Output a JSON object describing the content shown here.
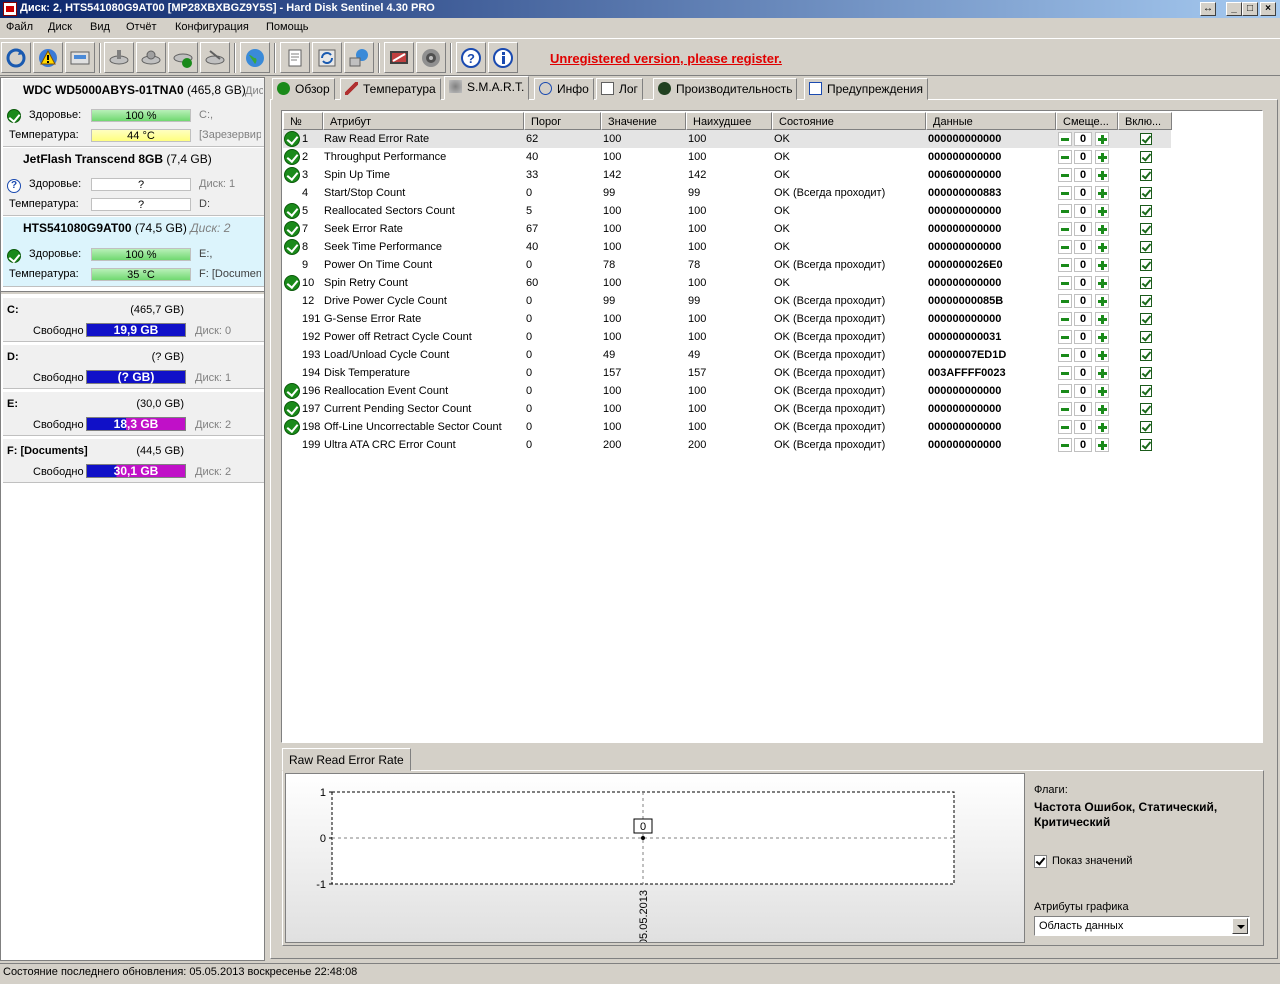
{
  "window": {
    "title": "Диск: 2, HTS541080G9AT00 [MP28XBXBGZ9Y5S]  -  Hard Disk Sentinel 4.30 PRO"
  },
  "menu": [
    "Файл",
    "Диск",
    "Вид",
    "Отчёт",
    "Конфигурация",
    "Помощь"
  ],
  "toolbar": {
    "icons": [
      "refresh-icon",
      "warning-icon",
      "disk-info-icon",
      "disk-test-icon",
      "disk-surface-icon",
      "disk-ok-icon",
      "disk-repair-icon",
      "globe-icon",
      "document-icon",
      "sync-icon",
      "network-icon",
      "report-icon",
      "speaker-icon",
      "help-icon",
      "about-icon"
    ],
    "unregistered": "Unregistered version, please register."
  },
  "disks": [
    {
      "name": "WDC WD5000ABYS-01TNA0",
      "size": "(465,8 GB)",
      "extra": "Дис",
      "health_label": "Здоровье:",
      "health": "100 %",
      "health_extra": "C:,",
      "temp_label": "Температура:",
      "temp": "44 °C",
      "temp_extra": "[Зарезервир"
    },
    {
      "name": "JetFlash Transcend 8GB",
      "size": "(7,4 GB)",
      "health_label": "Здоровье:",
      "health": "?",
      "health_extra": "Диск: 1",
      "temp_label": "Температура:",
      "temp": "?",
      "temp_extra": "D:"
    },
    {
      "name": "HTS541080G9AT00",
      "size": "(74,5 GB)",
      "extra": "Диск: 2",
      "health_label": "Здоровье:",
      "health": "100 %",
      "health_extra": "E:,",
      "temp_label": "Температура:",
      "temp": "35 °C",
      "temp_extra": "F: [Documen"
    }
  ],
  "volumes": [
    {
      "name": "C:",
      "size": "(465,7 GB)",
      "free_label": "Свободно",
      "free": "19,9 GB",
      "disk": "Диск: 0",
      "color": "#1010c8"
    },
    {
      "name": "D:",
      "size": "(? GB)",
      "free_label": "Свободно",
      "free": "(? GB)",
      "disk": "Диск: 1",
      "color": "#1010c8"
    },
    {
      "name": "E:",
      "size": "(30,0 GB)",
      "free_label": "Свободно",
      "free": "18,3 GB",
      "disk": "Диск: 2",
      "color": "#c010c8"
    },
    {
      "name": "F: [Documents]",
      "size": "(44,5 GB)",
      "free_label": "Свободно",
      "free": "30,1 GB",
      "disk": "Диск: 2",
      "color": "#c010c8"
    }
  ],
  "tabs": [
    "Обзор",
    "Температура",
    "S.M.A.R.T.",
    "Инфо",
    "Лог",
    "Производительность",
    "Предупреждения"
  ],
  "table": {
    "headers": [
      "№",
      "Атрибут",
      "Порог",
      "Значение",
      "Наихудшее",
      "Состояние",
      "Данные",
      "Смеще...",
      "Вклю..."
    ],
    "rows": [
      {
        "ok": true,
        "num": "1",
        "attr": "Raw Read Error Rate",
        "thr": "62",
        "val": "100",
        "worst": "100",
        "state": "OK",
        "data": "000000000000",
        "off": "0"
      },
      {
        "ok": true,
        "num": "2",
        "attr": "Throughput Performance",
        "thr": "40",
        "val": "100",
        "worst": "100",
        "state": "OK",
        "data": "000000000000",
        "off": "0"
      },
      {
        "ok": true,
        "num": "3",
        "attr": "Spin Up Time",
        "thr": "33",
        "val": "142",
        "worst": "142",
        "state": "OK",
        "data": "000600000000",
        "off": "0"
      },
      {
        "ok": false,
        "num": "4",
        "attr": "Start/Stop Count",
        "thr": "0",
        "val": "99",
        "worst": "99",
        "state": "OK (Всегда проходит)",
        "data": "000000000883",
        "off": "0"
      },
      {
        "ok": true,
        "num": "5",
        "attr": "Reallocated Sectors Count",
        "thr": "5",
        "val": "100",
        "worst": "100",
        "state": "OK",
        "data": "000000000000",
        "off": "0"
      },
      {
        "ok": true,
        "num": "7",
        "attr": "Seek Error Rate",
        "thr": "67",
        "val": "100",
        "worst": "100",
        "state": "OK",
        "data": "000000000000",
        "off": "0"
      },
      {
        "ok": true,
        "num": "8",
        "attr": "Seek Time Performance",
        "thr": "40",
        "val": "100",
        "worst": "100",
        "state": "OK",
        "data": "000000000000",
        "off": "0"
      },
      {
        "ok": false,
        "num": "9",
        "attr": "Power On Time Count",
        "thr": "0",
        "val": "78",
        "worst": "78",
        "state": "OK (Всегда проходит)",
        "data": "0000000026E0",
        "off": "0"
      },
      {
        "ok": true,
        "num": "10",
        "attr": "Spin Retry Count",
        "thr": "60",
        "val": "100",
        "worst": "100",
        "state": "OK",
        "data": "000000000000",
        "off": "0"
      },
      {
        "ok": false,
        "num": "12",
        "attr": "Drive Power Cycle Count",
        "thr": "0",
        "val": "99",
        "worst": "99",
        "state": "OK (Всегда проходит)",
        "data": "00000000085B",
        "off": "0"
      },
      {
        "ok": false,
        "num": "191",
        "attr": "G-Sense Error Rate",
        "thr": "0",
        "val": "100",
        "worst": "100",
        "state": "OK (Всегда проходит)",
        "data": "000000000000",
        "off": "0"
      },
      {
        "ok": false,
        "num": "192",
        "attr": "Power off Retract Cycle Count",
        "thr": "0",
        "val": "100",
        "worst": "100",
        "state": "OK (Всегда проходит)",
        "data": "000000000031",
        "off": "0"
      },
      {
        "ok": false,
        "num": "193",
        "attr": "Load/Unload Cycle Count",
        "thr": "0",
        "val": "49",
        "worst": "49",
        "state": "OK (Всегда проходит)",
        "data": "00000007ED1D",
        "off": "0"
      },
      {
        "ok": false,
        "num": "194",
        "attr": "Disk Temperature",
        "thr": "0",
        "val": "157",
        "worst": "157",
        "state": "OK (Всегда проходит)",
        "data": "003AFFFF0023",
        "off": "0"
      },
      {
        "ok": true,
        "num": "196",
        "attr": "Reallocation Event Count",
        "thr": "0",
        "val": "100",
        "worst": "100",
        "state": "OK (Всегда проходит)",
        "data": "000000000000",
        "off": "0"
      },
      {
        "ok": true,
        "num": "197",
        "attr": "Current Pending Sector Count",
        "thr": "0",
        "val": "100",
        "worst": "100",
        "state": "OK (Всегда проходит)",
        "data": "000000000000",
        "off": "0"
      },
      {
        "ok": true,
        "num": "198",
        "attr": "Off-Line Uncorrectable Sector Count",
        "thr": "0",
        "val": "100",
        "worst": "100",
        "state": "OK (Всегда проходит)",
        "data": "000000000000",
        "off": "0"
      },
      {
        "ok": false,
        "num": "199",
        "attr": "Ultra ATA CRC Error Count",
        "thr": "0",
        "val": "200",
        "worst": "200",
        "state": "OK (Всегда проходит)",
        "data": "000000000000",
        "off": "0"
      }
    ]
  },
  "bottom": {
    "tab": "Raw Read Error Rate",
    "flags_label": "Флаги:",
    "flags": "Частота Ошибок, Статический, Критический",
    "show_values": "Показ значений",
    "chart_attr_label": "Атрибуты графика",
    "chart_attr_value": "Область данных"
  },
  "chart_data": {
    "type": "line",
    "x": [
      "05.05.2013"
    ],
    "series": [
      {
        "values": [
          0
        ]
      }
    ],
    "ylim": [
      -1,
      1
    ],
    "yticks": [
      "1",
      "0",
      "-1"
    ],
    "point_label": "0",
    "grid": true
  },
  "status": "Состояние последнего обновления: 05.05.2013 воскресенье 22:48:08"
}
